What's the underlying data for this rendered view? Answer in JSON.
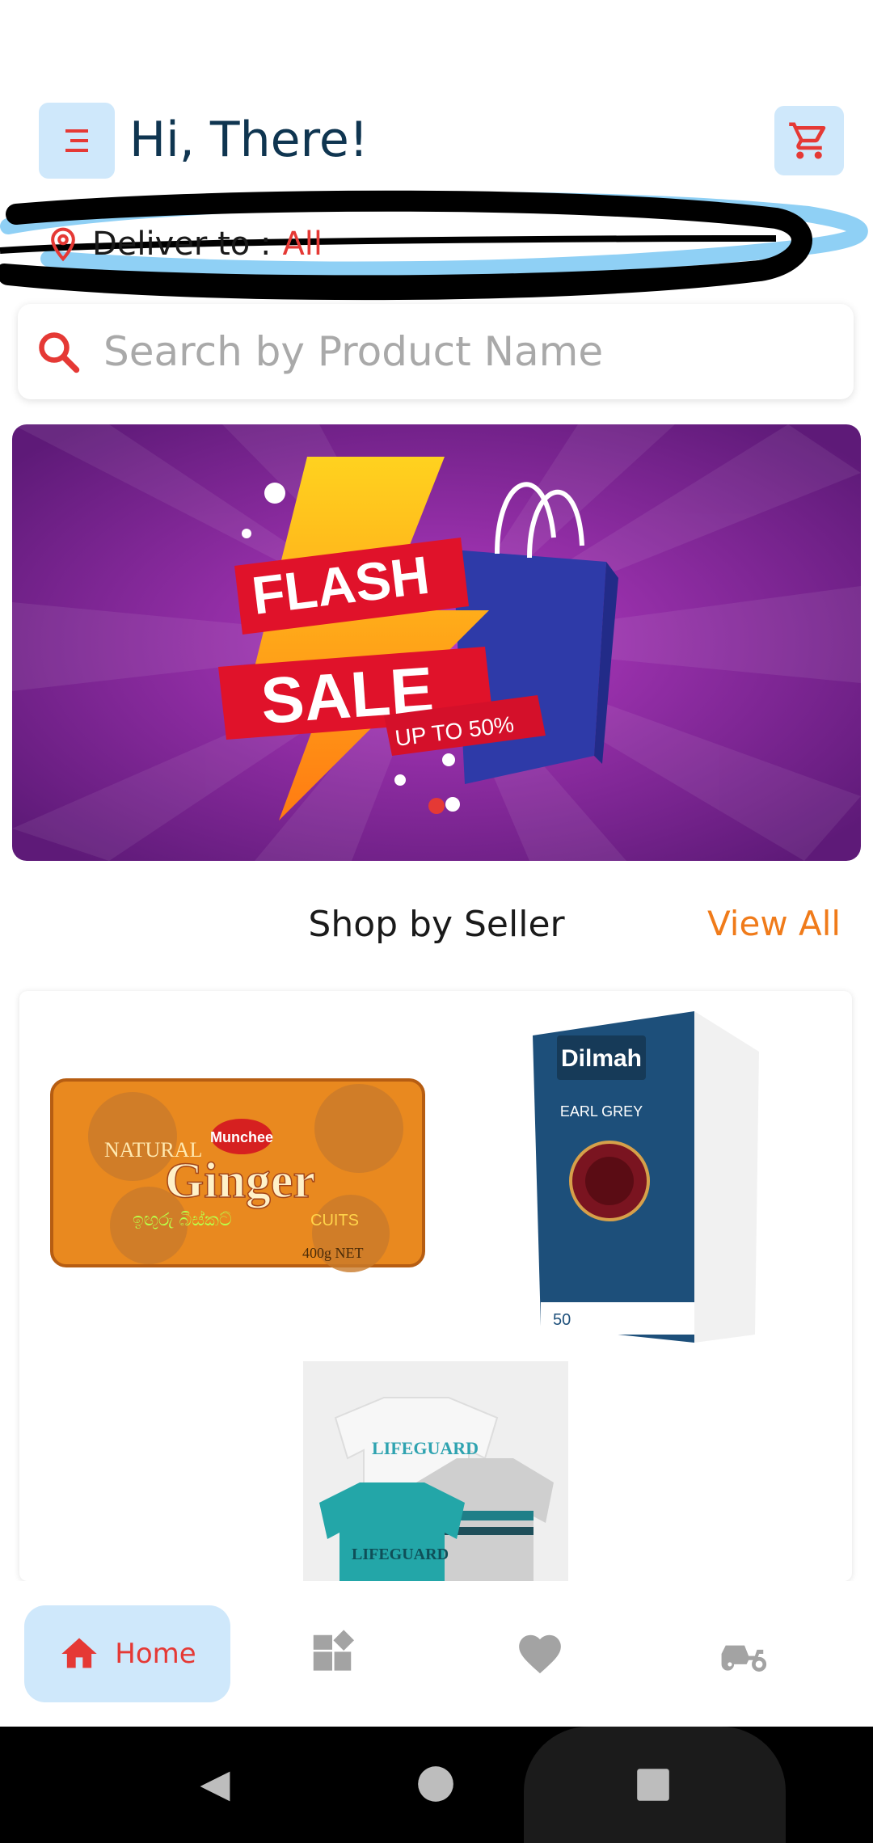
{
  "header": {
    "greeting": "Hi, There!",
    "menu_icon": "menu-icon",
    "cart_icon": "cart-icon"
  },
  "delivery": {
    "label": "Deliver to :",
    "value": "All",
    "icon": "location-pin-icon"
  },
  "search": {
    "placeholder": "Search by Product Name",
    "value": ""
  },
  "banner": {
    "line1": "FLASH",
    "line2": "SALE",
    "tag": "UP TO 50%",
    "active_slide_indicator": "carousel-dot"
  },
  "section": {
    "title": "Shop by Seller",
    "view_all": "View All"
  },
  "products": [
    {
      "name": "ginger-biscuits",
      "brand": "Munchee",
      "title": "Ginger",
      "subtitle": "NATURAL",
      "sinhala": "ඉඟුරු බිස්කට්",
      "suffix": "CUITS",
      "weight": "400g NET"
    },
    {
      "name": "dilmah-earl-grey",
      "brand": "Dilmah",
      "title": "EARL GREY",
      "count": "50"
    },
    {
      "name": "kids-tshirts",
      "print": "LIFEGUARD"
    }
  ],
  "bottom_nav": {
    "home_label": "Home",
    "items": [
      "home-icon",
      "categories-icon",
      "favorites-icon",
      "delivery-icon"
    ]
  },
  "colors": {
    "accent": "#e53935",
    "light_blue": "#cfe8fb",
    "title": "#0f3550",
    "view_all": "#f07b1a"
  }
}
